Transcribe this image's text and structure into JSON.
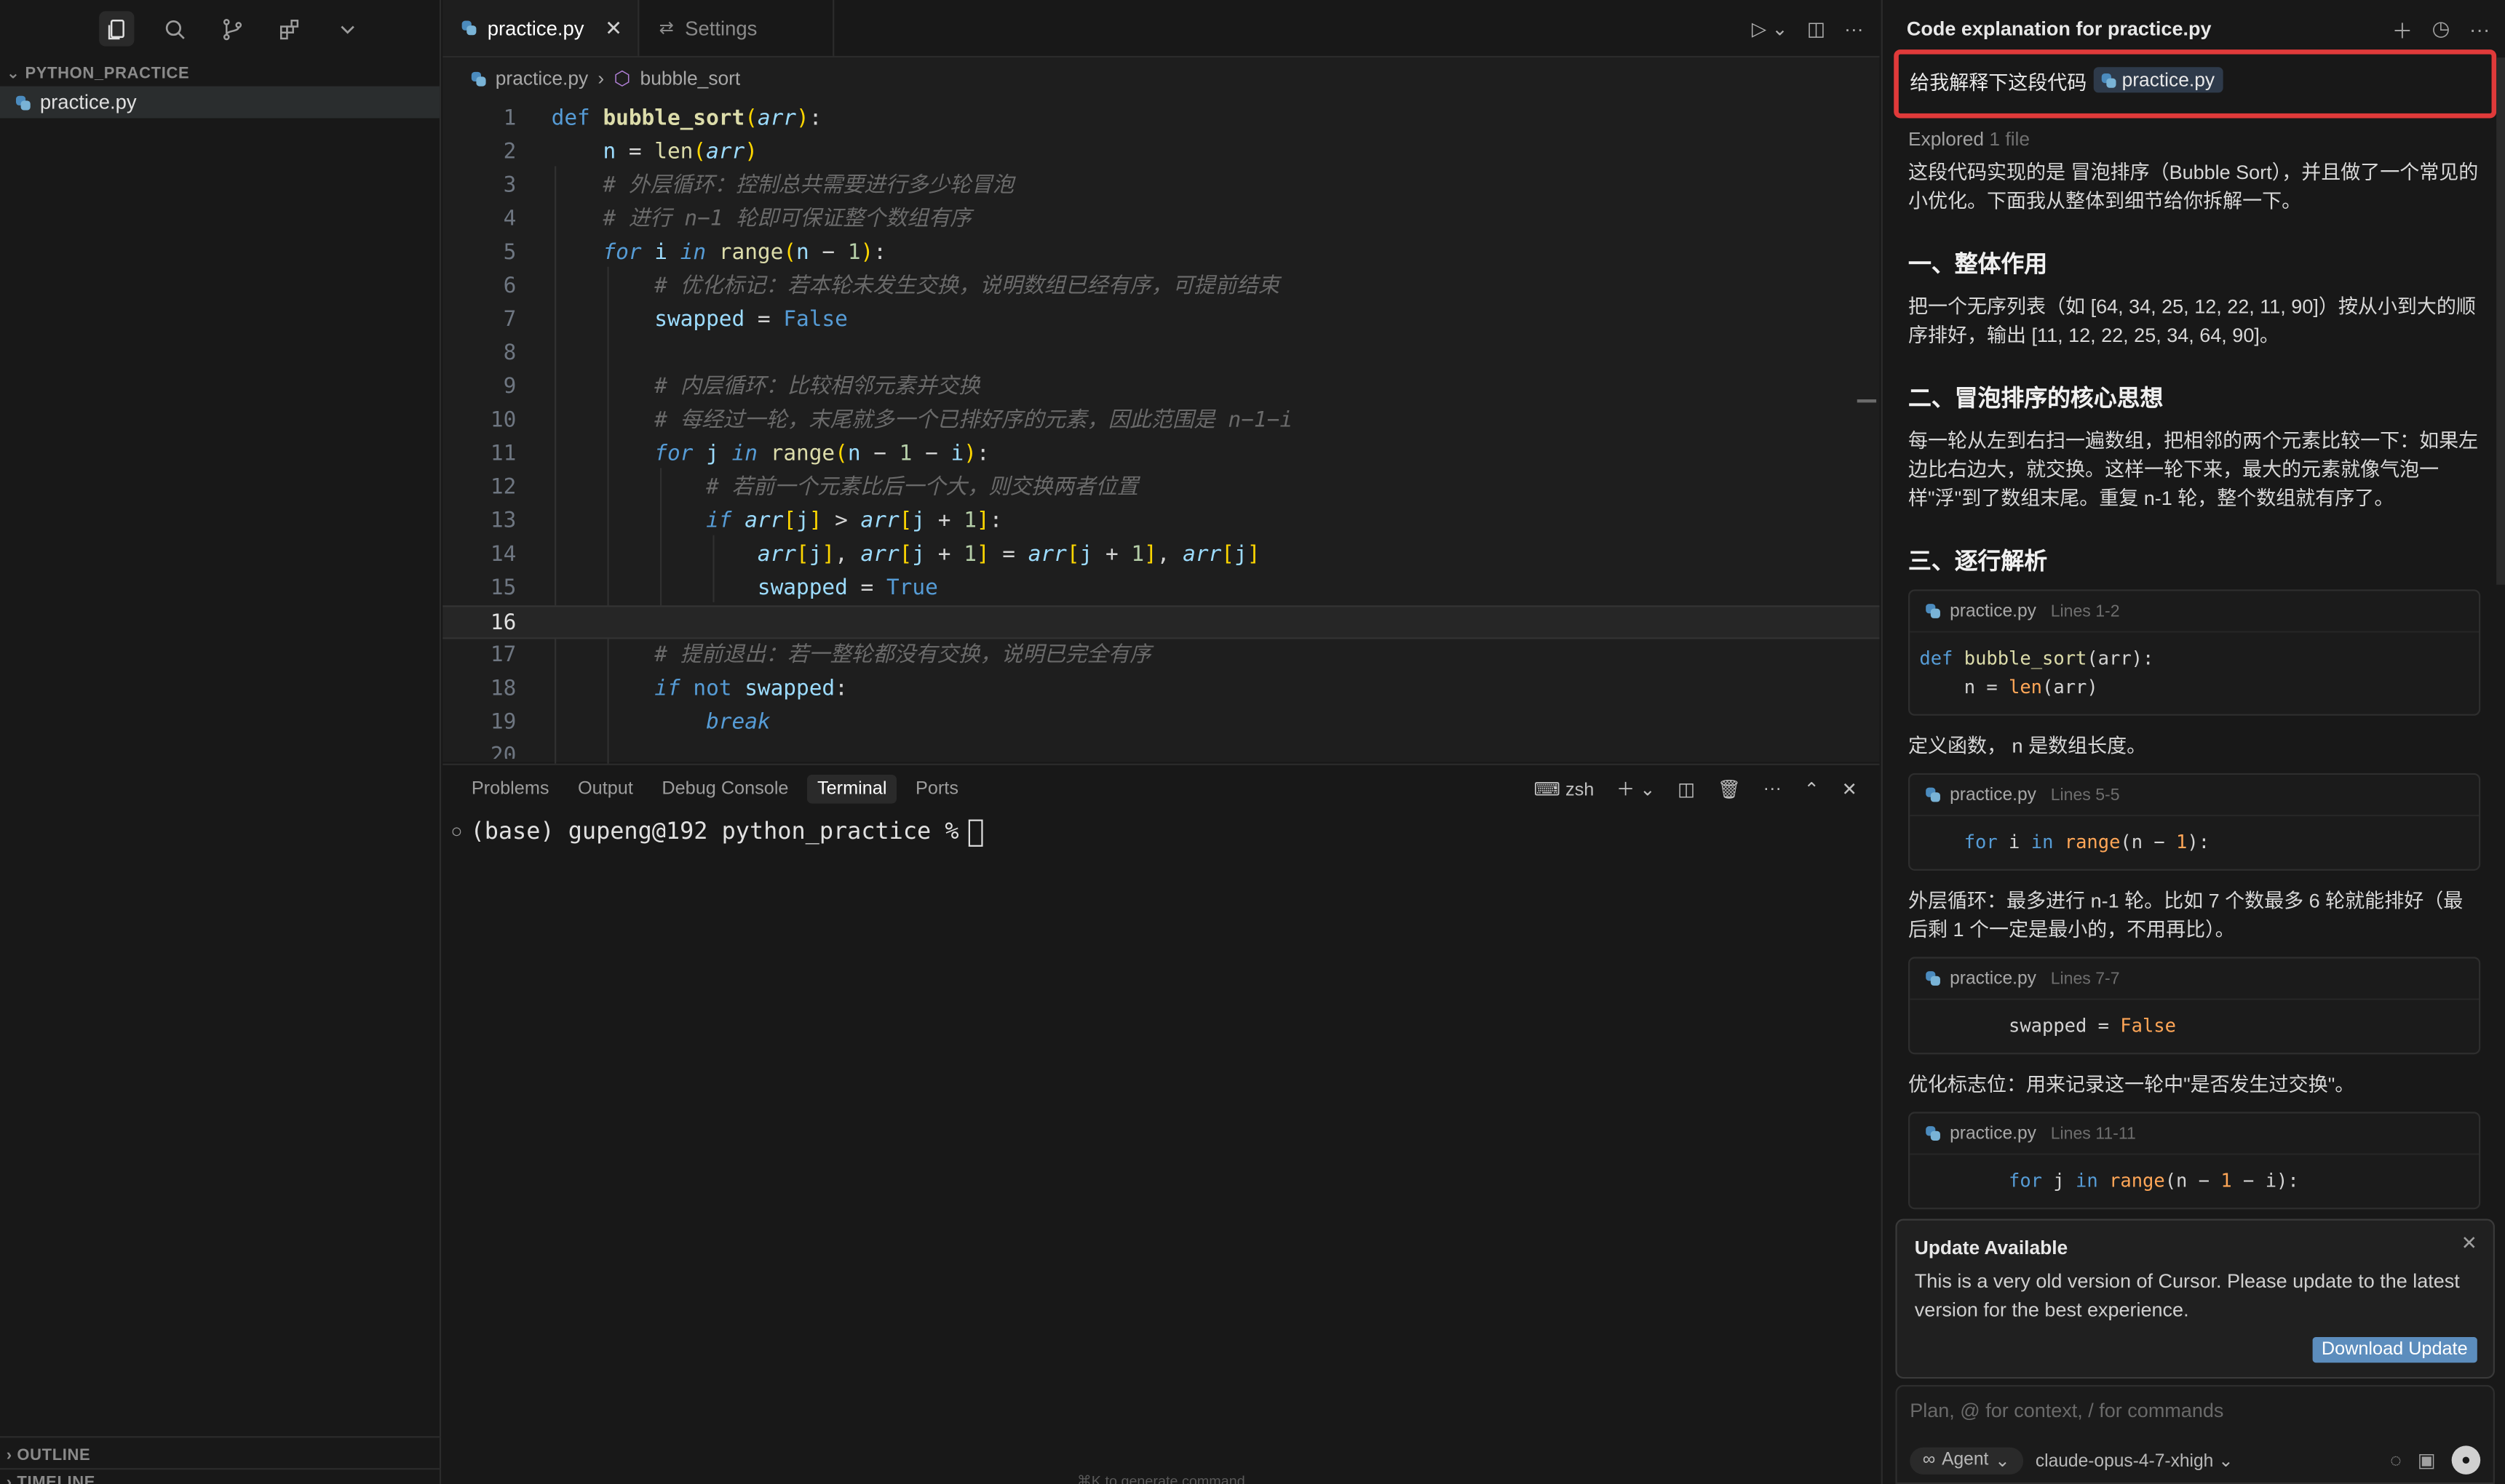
{
  "sidebar": {
    "explorer_title": "PYTHON_PRACTICE",
    "file": "practice.py",
    "outline_title": "OUTLINE",
    "timeline_title": "TIMELINE"
  },
  "editor": {
    "tabs": [
      {
        "label": "practice.py",
        "active": true
      },
      {
        "label": "Settings",
        "active": false
      }
    ],
    "breadcrumb": [
      "practice.py",
      "bubble_sort"
    ],
    "current_line": 16
  },
  "panel": {
    "tabs": [
      "Problems",
      "Output",
      "Debug Console",
      "Terminal",
      "Ports"
    ],
    "active_tab": "Terminal",
    "shell": "zsh",
    "prompt": "(base) gupeng@192 python_practice %",
    "hint": "⌘K to generate command"
  },
  "chat": {
    "title": "Code explanation for practice.py",
    "query": "给我解释下这段代码",
    "query_chip": "practice.py",
    "explored_label": "Explored",
    "explored_count": "1 file",
    "intro": "这段代码实现的是 冒泡排序（Bubble Sort），并且做了一个常见的小优化。下面我从整体到细节给你拆解一下。",
    "h1": "一、整体作用",
    "p1": "把一个无序列表（如 [64, 34, 25, 12, 22, 11, 90]）按从小到大的顺序排好，输出 [11, 12, 22, 25, 34, 64, 90]。",
    "h2": "二、冒泡排序的核心思想",
    "p2": "每一轮从左到右扫一遍数组，把相邻的两个元素比较一下：如果左边比右边大，就交换。这样一轮下来，最大的元素就像气泡一样\"浮\"到了数组末尾。重复 n-1 轮，整个数组就有序了。",
    "h3": "三、逐行解析",
    "blocks": [
      {
        "file": "practice.py",
        "lines": "Lines 1-2",
        "desc": "定义函数， n 是数组长度。"
      },
      {
        "file": "practice.py",
        "lines": "Lines 5-5",
        "desc": "外层循环：最多进行 n-1 轮。比如 7 个数最多 6 轮就能排好（最后剩 1 个一定是最小的，不用再比）。"
      },
      {
        "file": "practice.py",
        "lines": "Lines 7-7",
        "desc": "优化标志位：用来记录这一轮中\"是否发生过交换\"。"
      },
      {
        "file": "practice.py",
        "lines": "Lines 11-11",
        "desc": ""
      }
    ],
    "toast": {
      "title": "Update Available",
      "message": "This is a very old version of Cursor. Please update to the latest version for the best experience.",
      "button": "Download Update"
    },
    "input_placeholder": "Plan, @ for context, / for commands",
    "agent_label": "Agent",
    "model": "claude-opus-4-7-xhigh"
  },
  "code_lines": [
    "1",
    "2",
    "3",
    "4",
    "5",
    "6",
    "7",
    "8",
    "9",
    "10",
    "11",
    "12",
    "13",
    "14",
    "15",
    "16",
    "17",
    "18",
    "19",
    "20"
  ],
  "code_text": {
    "l1_kw": "def",
    "l1_fn": "bubble_sort",
    "c3": "# 外层循环：控制总共需要进行多少轮冒泡",
    "c4": "# 进行 n−1 轮即可保证整个数组有序",
    "c6": "# 优化标记：若本轮未发生交换，说明数组已经有序，可提前结束",
    "c9": "# 内层循环：比较相邻元素并交换",
    "c10": "# 每经过一轮，末尾就多一个已排好序的元素，因此范围是 n−1−i",
    "c12": "# 若前一个元素比后一个大，则交换两者位置",
    "c17": "# 提前退出：若一整轮都没有交换，说明已完全有序"
  }
}
